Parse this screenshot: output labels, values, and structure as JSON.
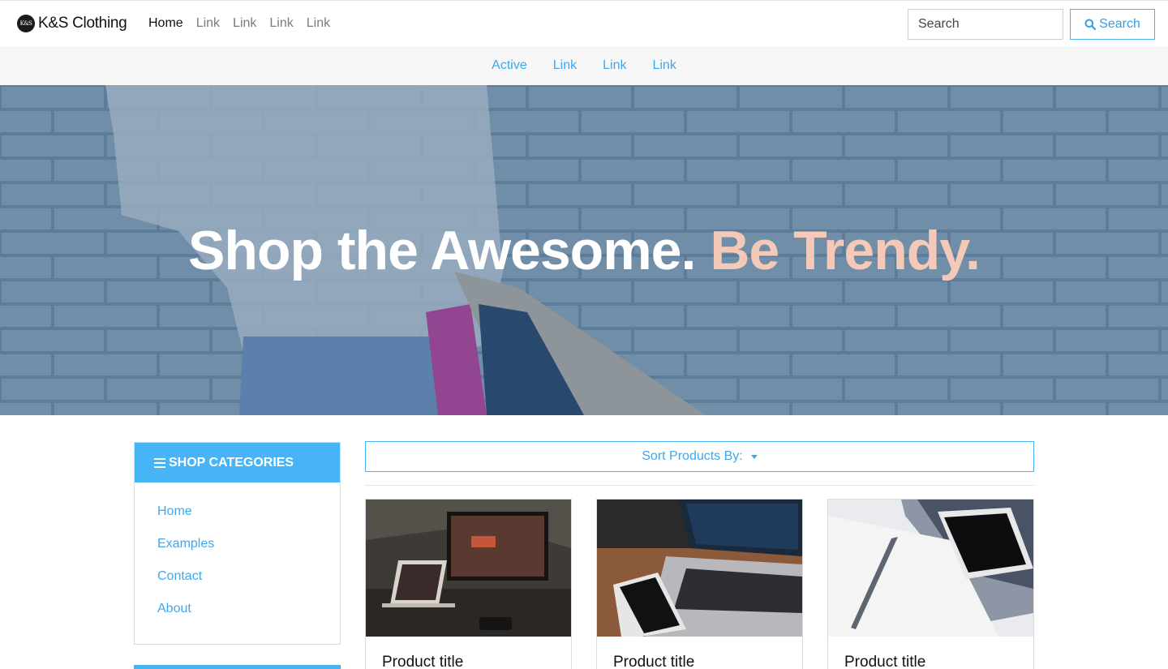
{
  "brand": {
    "logo_text": "K&S",
    "name": "K&S Clothing"
  },
  "topnav": {
    "links": [
      "Home",
      "Link",
      "Link",
      "Link",
      "Link"
    ]
  },
  "search": {
    "placeholder": "Search",
    "button_label": "Search"
  },
  "subnav": {
    "links": [
      "Active",
      "Link",
      "Link",
      "Link"
    ]
  },
  "hero": {
    "title_main": "Shop the Awesome.",
    "title_accent": "Be Trendy."
  },
  "sidebar": {
    "heading": "SHOP CATEGORIES",
    "items": [
      "Home",
      "Examples",
      "Contact",
      "About"
    ]
  },
  "sort": {
    "label": "Sort Products By:"
  },
  "products": [
    {
      "title": "Product title"
    },
    {
      "title": "Product title"
    },
    {
      "title": "Product title"
    }
  ],
  "colors": {
    "accent": "#47b4f5",
    "link": "#3ea8ec",
    "hero_accent": "#f4c9b8"
  }
}
